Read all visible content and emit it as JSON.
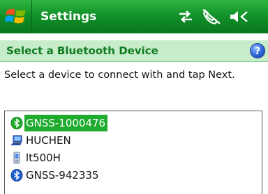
{
  "titlebar": {
    "title": "Settings",
    "start_icon": "windows-flag-icon",
    "status_icons": [
      "connectivity-icon",
      "no-phone-icon",
      "speaker-muted-icon"
    ]
  },
  "subheader": {
    "title": "Select a Bluetooth Device",
    "help_label": "?"
  },
  "instruction": "Select a device to connect with and tap Next.",
  "devices": [
    {
      "label": "GNSS-1000476",
      "icon": "bluetooth-icon",
      "selected": true
    },
    {
      "label": "HUCHEN",
      "icon": "computer-icon",
      "selected": false
    },
    {
      "label": "lt500H",
      "icon": "mobile-device-icon",
      "selected": false
    },
    {
      "label": "GNSS-942335",
      "icon": "bluetooth-icon",
      "selected": false
    }
  ],
  "colors": {
    "titlebar_green": "#12922a",
    "subheader_bg": "#c6ecc9",
    "subheader_text": "#0f7a21",
    "selection_green": "#1fab2e",
    "help_blue": "#2c64d8"
  }
}
